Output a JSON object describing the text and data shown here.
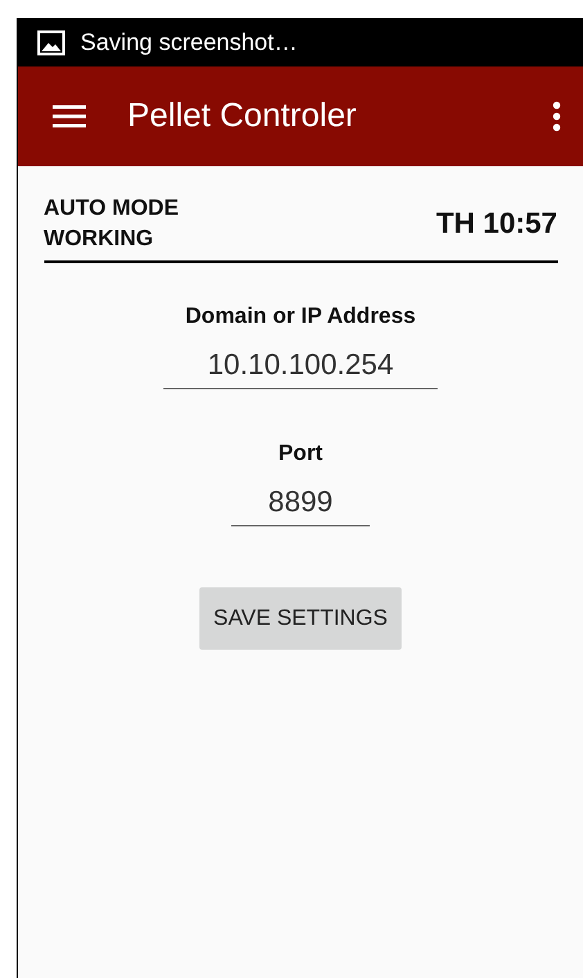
{
  "status_bar": {
    "notification": "Saving screenshot…"
  },
  "app_bar": {
    "title": "Pellet Controler"
  },
  "status": {
    "lines": [
      "AUTO MODE",
      "WORKING"
    ],
    "time": "TH 10:57"
  },
  "fields": [
    {
      "label": "Domain or IP Address",
      "value": "10.10.100.254"
    },
    {
      "label": "Port",
      "value": "8899"
    }
  ],
  "button": "SAVE SETTINGS"
}
